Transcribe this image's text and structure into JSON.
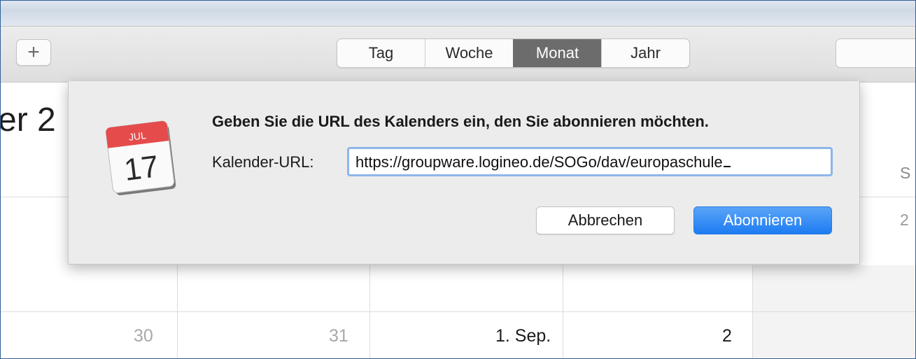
{
  "toolbar": {
    "add_label": "+",
    "views": [
      {
        "label": "Tag",
        "active": false
      },
      {
        "label": "Woche",
        "active": false
      },
      {
        "label": "Monat",
        "active": true
      },
      {
        "label": "Jahr",
        "active": false
      }
    ]
  },
  "calendar": {
    "month_title_partial": "er 2",
    "weekday_partial": "S",
    "days": [
      "30",
      "31",
      "1. Sep.",
      "2"
    ],
    "right_day_partial": "2"
  },
  "sheet": {
    "icon": "calendar-icon",
    "icon_month": "JUL",
    "icon_day": "17",
    "message": "Geben Sie die URL des Kalenders ein, den Sie abonnieren möchten.",
    "url_label": "Kalender-URL:",
    "url_value": "https://groupware.logineo.de/SOGo/dav/europaschule",
    "cancel_label": "Abbrechen",
    "confirm_label": "Abonnieren"
  },
  "colors": {
    "accent": "#1d7cf2",
    "active_segment": "#6c6c6c",
    "icon_red": "#e54b4b"
  }
}
